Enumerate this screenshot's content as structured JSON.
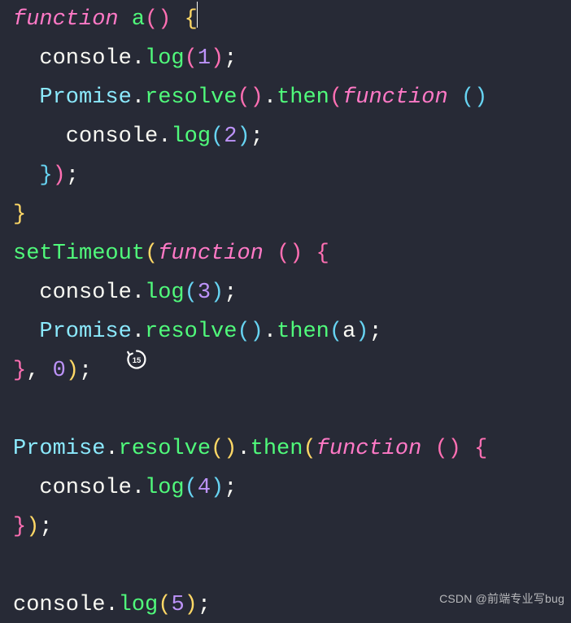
{
  "code": {
    "lines": [
      [
        {
          "t": "function ",
          "c": "tok-kw"
        },
        {
          "t": "a",
          "c": "tok-fn"
        },
        {
          "t": "(",
          "c": "tok-brP"
        },
        {
          "t": ")",
          "c": "tok-brP"
        },
        {
          "t": " ",
          "c": "tok-p"
        },
        {
          "t": "{",
          "c": "tok-br",
          "cursor": true
        }
      ],
      [
        {
          "t": "  console",
          "c": "tok-id"
        },
        {
          "t": ".",
          "c": "tok-p"
        },
        {
          "t": "log",
          "c": "tok-fn"
        },
        {
          "t": "(",
          "c": "tok-brP"
        },
        {
          "t": "1",
          "c": "tok-num"
        },
        {
          "t": ")",
          "c": "tok-brP"
        },
        {
          "t": ";",
          "c": "tok-p"
        }
      ],
      [
        {
          "t": "  Promise",
          "c": "tok-prop"
        },
        {
          "t": ".",
          "c": "tok-p"
        },
        {
          "t": "resolve",
          "c": "tok-fn"
        },
        {
          "t": "(",
          "c": "tok-brP"
        },
        {
          "t": ")",
          "c": "tok-brP"
        },
        {
          "t": ".",
          "c": "tok-p"
        },
        {
          "t": "then",
          "c": "tok-fn"
        },
        {
          "t": "(",
          "c": "tok-brP"
        },
        {
          "t": "function ",
          "c": "tok-kw"
        },
        {
          "t": "(",
          "c": "tok-brB"
        },
        {
          "t": ")",
          "c": "tok-brB"
        }
      ],
      [
        {
          "t": "    console",
          "c": "tok-id"
        },
        {
          "t": ".",
          "c": "tok-p"
        },
        {
          "t": "log",
          "c": "tok-fn"
        },
        {
          "t": "(",
          "c": "tok-brB"
        },
        {
          "t": "2",
          "c": "tok-num"
        },
        {
          "t": ")",
          "c": "tok-brB"
        },
        {
          "t": ";",
          "c": "tok-p"
        }
      ],
      [
        {
          "t": "  }",
          "c": "tok-brB"
        },
        {
          "t": ")",
          "c": "tok-brP"
        },
        {
          "t": ";",
          "c": "tok-p"
        }
      ],
      [
        {
          "t": "}",
          "c": "tok-br"
        }
      ],
      [
        {
          "t": "setTimeout",
          "c": "tok-fn"
        },
        {
          "t": "(",
          "c": "tok-br"
        },
        {
          "t": "function ",
          "c": "tok-kw"
        },
        {
          "t": "(",
          "c": "tok-brP"
        },
        {
          "t": ")",
          "c": "tok-brP"
        },
        {
          "t": " ",
          "c": "tok-p"
        },
        {
          "t": "{",
          "c": "tok-brP"
        }
      ],
      [
        {
          "t": "  console",
          "c": "tok-id"
        },
        {
          "t": ".",
          "c": "tok-p"
        },
        {
          "t": "log",
          "c": "tok-fn"
        },
        {
          "t": "(",
          "c": "tok-brB"
        },
        {
          "t": "3",
          "c": "tok-num"
        },
        {
          "t": ")",
          "c": "tok-brB"
        },
        {
          "t": ";",
          "c": "tok-p"
        }
      ],
      [
        {
          "t": "  Promise",
          "c": "tok-prop"
        },
        {
          "t": ".",
          "c": "tok-p"
        },
        {
          "t": "resolve",
          "c": "tok-fn"
        },
        {
          "t": "(",
          "c": "tok-brB"
        },
        {
          "t": ")",
          "c": "tok-brB"
        },
        {
          "t": ".",
          "c": "tok-p"
        },
        {
          "t": "then",
          "c": "tok-fn"
        },
        {
          "t": "(",
          "c": "tok-brB"
        },
        {
          "t": "a",
          "c": "tok-id"
        },
        {
          "t": ")",
          "c": "tok-brB"
        },
        {
          "t": ";",
          "c": "tok-p"
        }
      ],
      [
        {
          "t": "}",
          "c": "tok-brP"
        },
        {
          "t": ", ",
          "c": "tok-p"
        },
        {
          "t": "0",
          "c": "tok-num"
        },
        {
          "t": ")",
          "c": "tok-br"
        },
        {
          "t": ";",
          "c": "tok-p"
        }
      ],
      [
        {
          "t": "",
          "c": ""
        }
      ],
      [
        {
          "t": "Promise",
          "c": "tok-prop"
        },
        {
          "t": ".",
          "c": "tok-p"
        },
        {
          "t": "resolve",
          "c": "tok-fn"
        },
        {
          "t": "(",
          "c": "tok-br"
        },
        {
          "t": ")",
          "c": "tok-br"
        },
        {
          "t": ".",
          "c": "tok-p"
        },
        {
          "t": "then",
          "c": "tok-fn"
        },
        {
          "t": "(",
          "c": "tok-br"
        },
        {
          "t": "function ",
          "c": "tok-kw"
        },
        {
          "t": "(",
          "c": "tok-brP"
        },
        {
          "t": ")",
          "c": "tok-brP"
        },
        {
          "t": " ",
          "c": "tok-p"
        },
        {
          "t": "{",
          "c": "tok-brP"
        }
      ],
      [
        {
          "t": "  console",
          "c": "tok-id"
        },
        {
          "t": ".",
          "c": "tok-p"
        },
        {
          "t": "log",
          "c": "tok-fn"
        },
        {
          "t": "(",
          "c": "tok-brB"
        },
        {
          "t": "4",
          "c": "tok-num"
        },
        {
          "t": ")",
          "c": "tok-brB"
        },
        {
          "t": ";",
          "c": "tok-p"
        }
      ],
      [
        {
          "t": "}",
          "c": "tok-brP"
        },
        {
          "t": ")",
          "c": "tok-br"
        },
        {
          "t": ";",
          "c": "tok-p"
        }
      ],
      [
        {
          "t": "",
          "c": ""
        }
      ],
      [
        {
          "t": "console",
          "c": "tok-id"
        },
        {
          "t": ".",
          "c": "tok-p"
        },
        {
          "t": "log",
          "c": "tok-fn"
        },
        {
          "t": "(",
          "c": "tok-br"
        },
        {
          "t": "5",
          "c": "tok-num"
        },
        {
          "t": ")",
          "c": "tok-br"
        },
        {
          "t": ";",
          "c": "tok-p"
        }
      ]
    ]
  },
  "overlay": {
    "label": "15"
  },
  "watermark": {
    "text": "CSDN @前端专业写bug"
  }
}
